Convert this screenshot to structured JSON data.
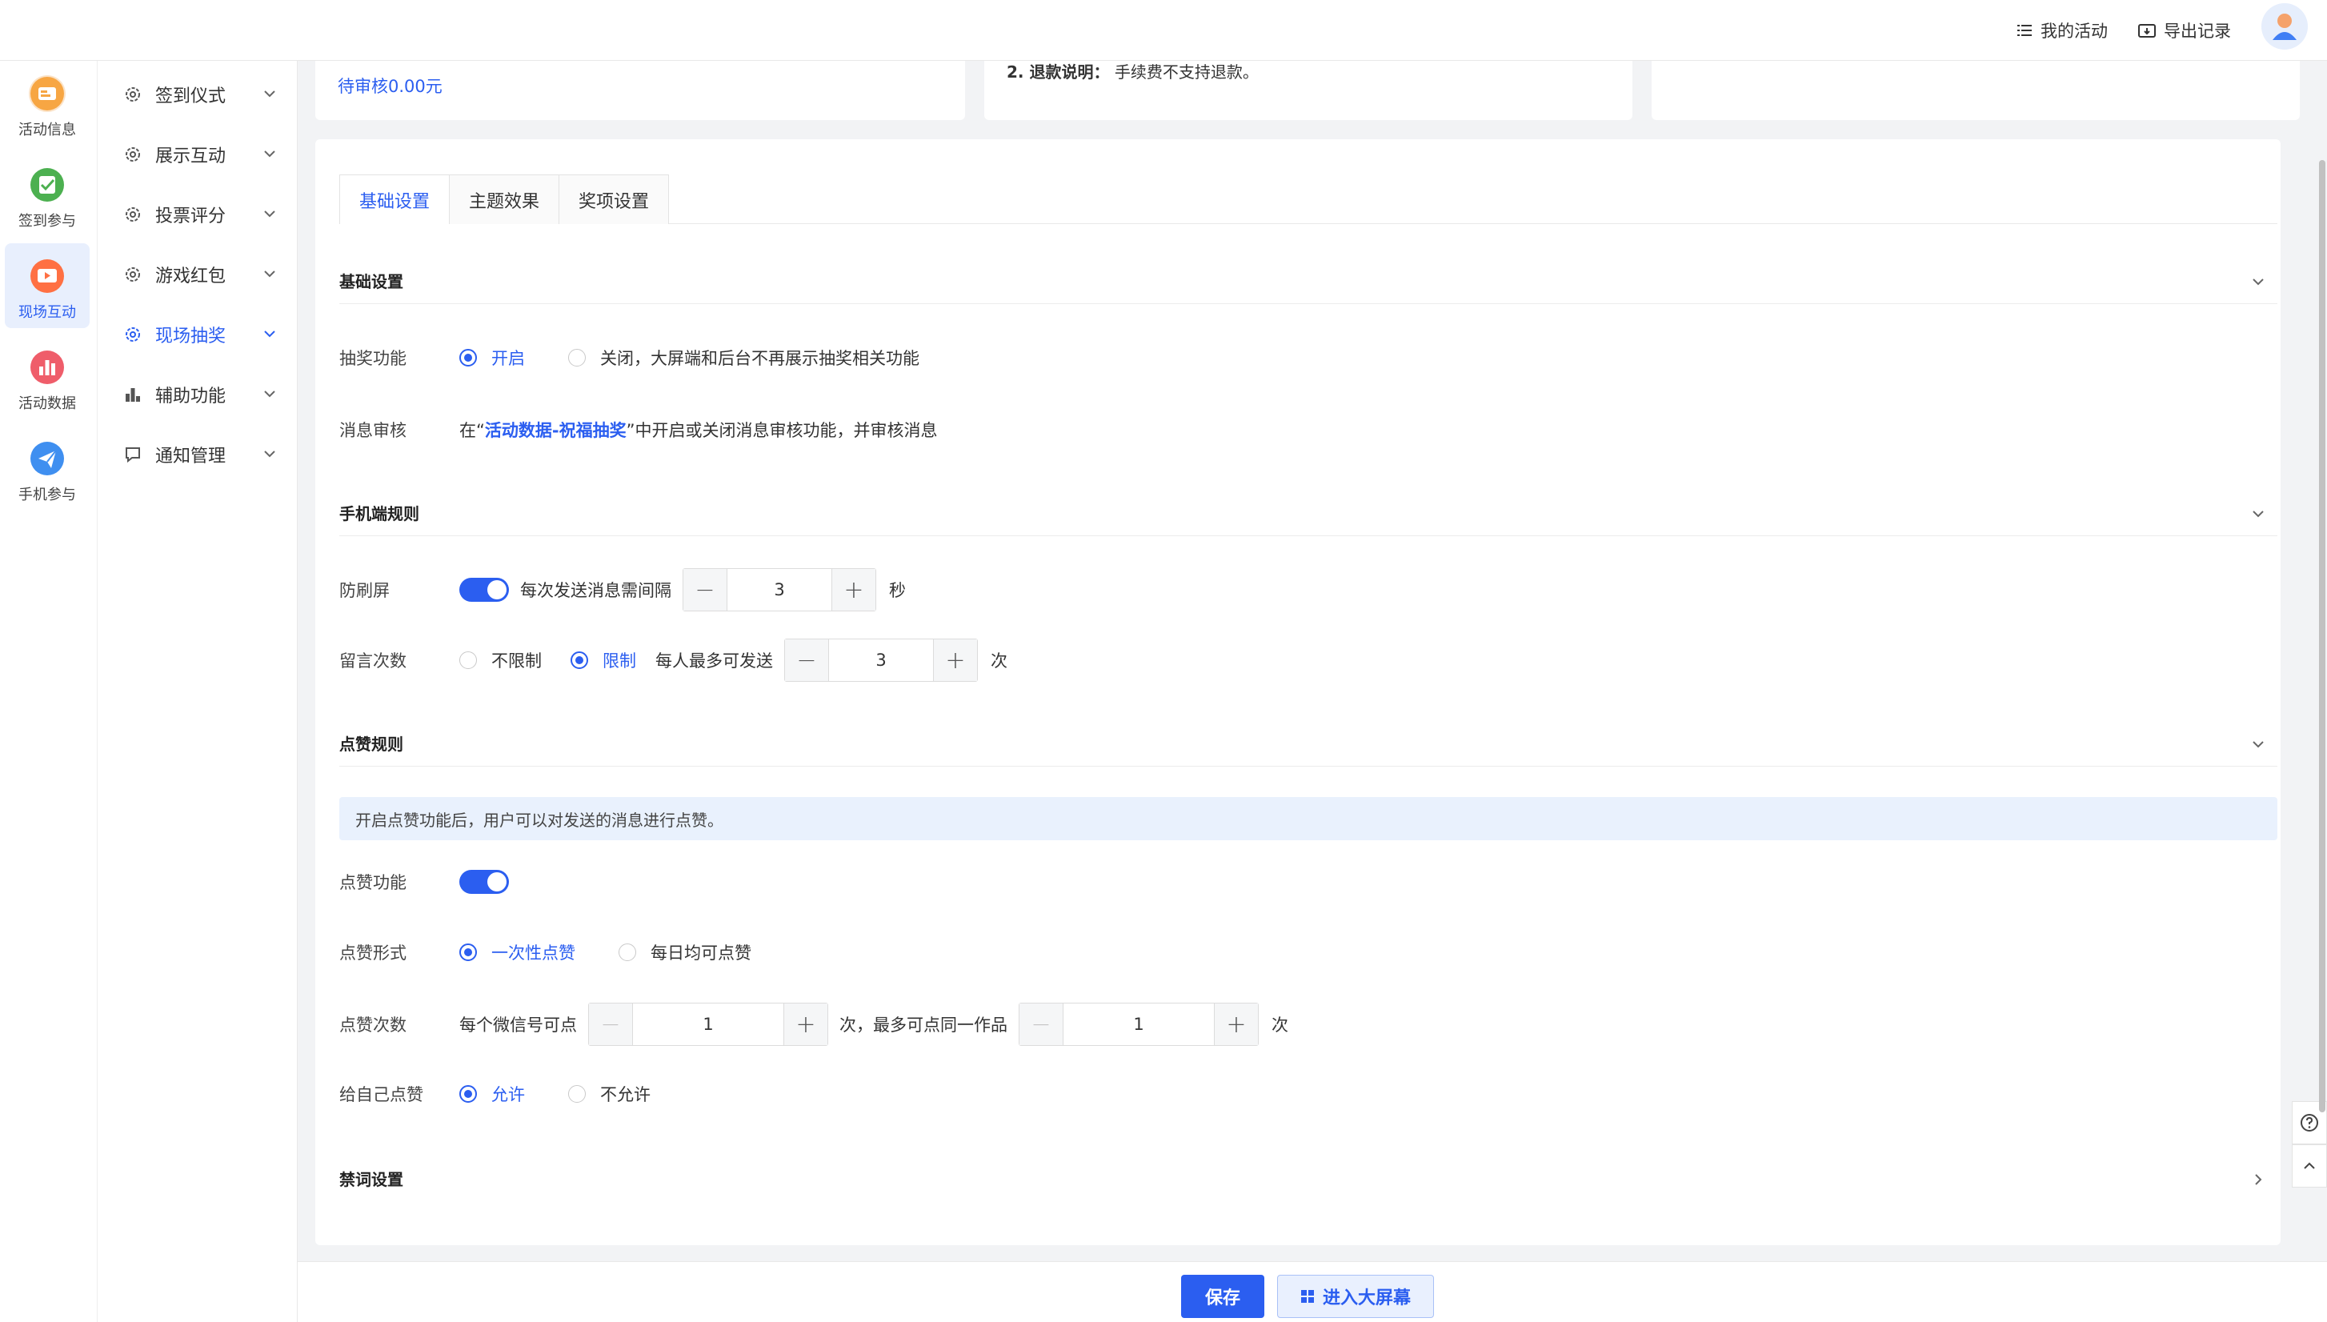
{
  "header": {
    "my_activities": "我的活动",
    "export_records": "导出记录"
  },
  "rail": {
    "items": [
      {
        "label": "活动信息",
        "icon": "activity-info-icon",
        "color": "#f5a623"
      },
      {
        "label": "签到参与",
        "icon": "checkin-icon",
        "color": "#4caf50"
      },
      {
        "label": "现场互动",
        "icon": "live-interaction-icon",
        "color": "#ff7043"
      },
      {
        "label": "活动数据",
        "icon": "data-chart-icon",
        "color": "#ef5350"
      },
      {
        "label": "手机参与",
        "icon": "paper-plane-icon",
        "color": "#42a5f5"
      }
    ],
    "active_index": 2
  },
  "submenu": {
    "items": [
      {
        "label": "签到仪式"
      },
      {
        "label": "展示互动"
      },
      {
        "label": "投票评分"
      },
      {
        "label": "游戏红包"
      },
      {
        "label": "现场抽奖"
      },
      {
        "label": "辅助功能"
      },
      {
        "label": "通知管理"
      }
    ],
    "active_index": 4
  },
  "cards": {
    "pending": "待审核0.00元",
    "refund_label": "2. 退款说明：",
    "refund_text": "手续费不支持退款。"
  },
  "tabs": [
    "基础设置",
    "主题效果",
    "奖项设置"
  ],
  "active_tab": 0,
  "basic": {
    "section_title": "基础设置",
    "lottery_label": "抽奖功能",
    "lottery_on": "开启",
    "lottery_off": "关闭，大屏端和后台不再展示抽奖相关功能",
    "review_label": "消息审核",
    "review_prefix": "在“",
    "review_link": "活动数据-祝福抽奖",
    "review_suffix": "”中开启或关闭消息审核功能，并审核消息"
  },
  "mobile": {
    "section_title": "手机端规则",
    "antispam_label": "防刷屏",
    "antispam_text": "每次发送消息需间隔",
    "antispam_value": "3",
    "antispam_unit": "秒",
    "msg_count_label": "留言次数",
    "unlimited": "不限制",
    "limited": "限制",
    "limit_text": "每人最多可发送",
    "limit_value": "3",
    "limit_unit": "次"
  },
  "like": {
    "section_title": "点赞规则",
    "notice": "开启点赞功能后，用户可以对发送的消息进行点赞。",
    "feature_label": "点赞功能",
    "form_label": "点赞形式",
    "form_once": "一次性点赞",
    "form_daily": "每日均可点赞",
    "count_label": "点赞次数",
    "count_prefix": "每个微信号可点",
    "count_value": "1",
    "count_mid": "次，最多可点同一作品",
    "same_value": "1",
    "count_unit": "次",
    "self_label": "给自己点赞",
    "self_allow": "允许",
    "self_deny": "不允许"
  },
  "banned": {
    "section_title": "禁词设置"
  },
  "footer": {
    "save": "保存",
    "enter_screen": "进入大屏幕"
  },
  "colors": {
    "primary": "#2b5ef0",
    "notice_bg": "#e9f1fd"
  }
}
